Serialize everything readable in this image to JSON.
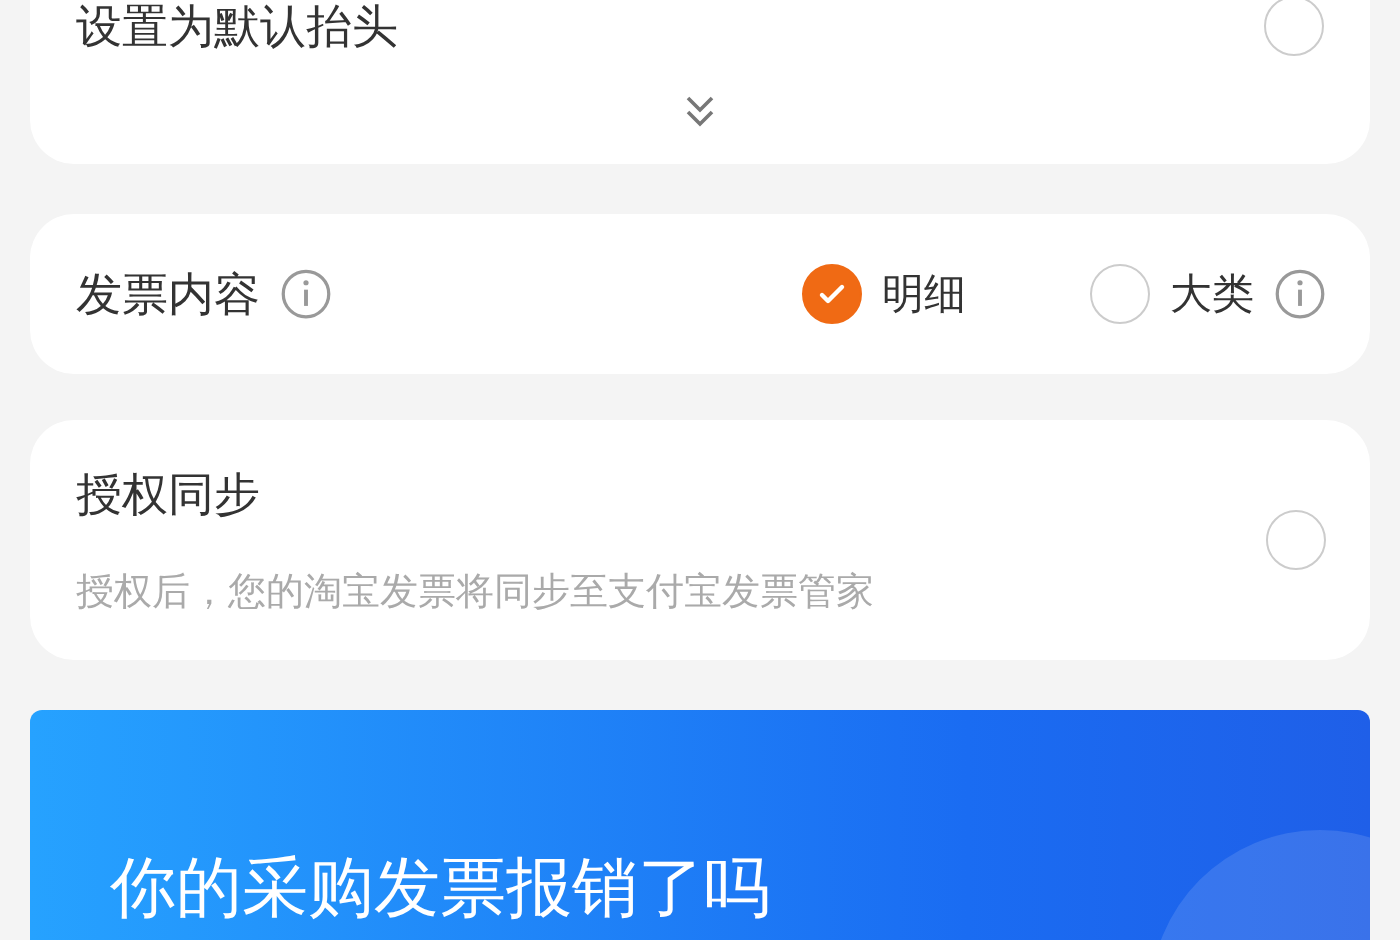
{
  "default_title": {
    "label": "设置为默认抬头",
    "checked": false
  },
  "invoice_content": {
    "label": "发票内容",
    "options": [
      {
        "label": "明细",
        "selected": true
      },
      {
        "label": "大类",
        "selected": false
      }
    ]
  },
  "auth_sync": {
    "title": "授权同步",
    "description": "授权后，您的淘宝发票将同步至支付宝发票管家",
    "checked": false
  },
  "banner": {
    "title": "你的采购发票报销了吗"
  }
}
